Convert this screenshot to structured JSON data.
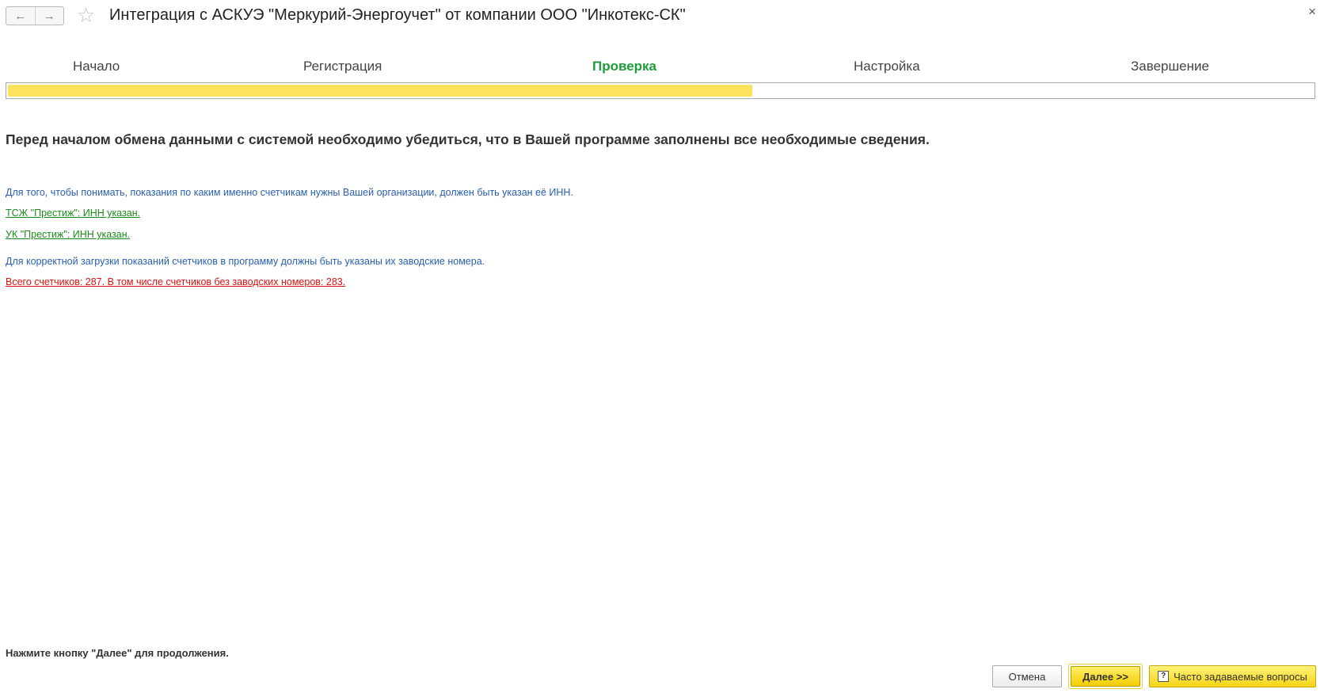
{
  "window": {
    "title": "Интеграция с АСКУЭ \"Меркурий-Энергоучет\" от компании ООО \"Инкотекс-СК\"",
    "back_icon": "←",
    "forward_icon": "→",
    "star_icon": "☆",
    "close_icon": "×"
  },
  "steps": [
    {
      "label": "Начало"
    },
    {
      "label": "Регистрация"
    },
    {
      "label": "Проверка",
      "active": true
    },
    {
      "label": "Настройка"
    },
    {
      "label": "Завершение"
    }
  ],
  "progress": {
    "value_percent": 57,
    "color": "#fbe35c"
  },
  "content": {
    "headline": "Перед началом обмена данными с системой необходимо убедиться, что в Вашей программе заполнены все необходимые сведения.",
    "inn_info": "Для того, чтобы понимать, показания по каким именно счетчикам нужны Вашей организации, должен быть указан её ИНН.",
    "org1_status": "ТСЖ \"Престиж\": ИНН указан.",
    "org2_status": "УК \"Престиж\": ИНН указан.",
    "meters_info": "Для корректной загрузки показаний счетчиков в программу должны быть указаны их заводские номера.",
    "meters_warning": "Всего счетчиков: 287. В том числе счетчиков без заводских номеров: 283."
  },
  "footer": {
    "hint": "Нажмите кнопку \"Далее\" для продолжения.",
    "cancel_label": "Отмена",
    "next_label": "Далее >>",
    "faq_label": "Часто задаваемые вопросы",
    "faq_icon": "?"
  },
  "colors": {
    "active_step": "#1e9c3b",
    "info_text": "#2a5fb0",
    "ok_link": "#1b8a1b",
    "warning_link": "#e01010",
    "accent_button": "#f5d417"
  }
}
